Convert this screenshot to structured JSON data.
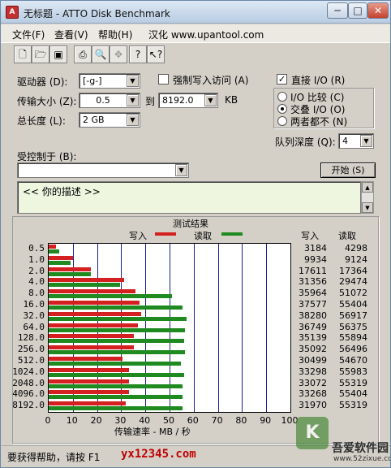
{
  "window": {
    "title": "无标题 - ATTO Disk Benchmark",
    "min_glyph": "─",
    "max_glyph": "□",
    "close_glyph": "✕",
    "icon_glyph": "A"
  },
  "menu": {
    "file": "文件(F)",
    "view": "查看(V)",
    "help": "帮助(H)",
    "localized": "汉化 www.upantool.com"
  },
  "toolbar": [
    {
      "name": "new-icon",
      "glyph": "🗋",
      "enabled": true
    },
    {
      "name": "open-icon",
      "glyph": "🗁",
      "enabled": true
    },
    {
      "name": "save-icon",
      "glyph": "▣",
      "enabled": true
    },
    {
      "name": "print-icon",
      "glyph": "⎙",
      "enabled": true
    },
    {
      "name": "print-preview-icon",
      "glyph": "🔍",
      "enabled": true
    },
    {
      "name": "move-icon",
      "glyph": "✥",
      "enabled": false
    },
    {
      "name": "help-icon",
      "glyph": "?",
      "enabled": true
    },
    {
      "name": "context-help-icon",
      "glyph": "↖?",
      "enabled": true
    }
  ],
  "settings": {
    "drive_label": "驱动器 (D):",
    "drive_value": "[-g-]",
    "force_write_label": "强制写入访问 (A)",
    "force_write_checked": false,
    "direct_io_label": "直接 I/O (R)",
    "direct_io_checked": true,
    "transfer_label": "传输大小 (Z):",
    "transfer_from": "0.5",
    "to_label": "到",
    "transfer_to": "8192.0",
    "unit": "KB",
    "length_label": "总长度 (L):",
    "length_value": "2 GB",
    "io_compare_label": "I/O 比较 (C)",
    "overlapped_label": "交叠 I/O (O)",
    "neither_label": "两者都不 (N)",
    "mode_selected": "overlapped",
    "queue_label": "队列深度 (Q):",
    "queue_value": "4",
    "controlled_label": "受控制于 (B):",
    "controlled_value": "",
    "start_label": "开始 (S)",
    "description": "<<  你的描述  >>"
  },
  "results": {
    "title": "测试结果",
    "write_label": "写入",
    "read_label": "读取",
    "col_write": "写入",
    "col_read": "读取",
    "x_title": "传输速率 - MB / 秒",
    "colors": {
      "write": "#d42020",
      "read": "#1f8a1f"
    }
  },
  "chart_data": {
    "type": "bar",
    "orientation": "horizontal",
    "categories": [
      "0.5",
      "1.0",
      "2.0",
      "4.0",
      "8.0",
      "16.0",
      "32.0",
      "64.0",
      "128.0",
      "256.0",
      "512.0",
      "1024.0",
      "2048.0",
      "4096.0",
      "8192.0"
    ],
    "series": [
      {
        "name": "写入",
        "values": [
          3184,
          9934,
          17611,
          31356,
          35964,
          37577,
          38280,
          36749,
          35139,
          35092,
          30499,
          33298,
          33072,
          33268,
          31970
        ]
      },
      {
        "name": "读取",
        "values": [
          4298,
          9124,
          17364,
          29474,
          51072,
          55404,
          56917,
          56375,
          55894,
          56496,
          54670,
          55983,
          55319,
          55404,
          55319
        ]
      }
    ],
    "xlabel": "传输速率 - MB / 秒",
    "xlim": [
      0,
      100
    ],
    "x_ticks": [
      0,
      10,
      20,
      30,
      40,
      50,
      60,
      70,
      80,
      90,
      100
    ],
    "grid": true,
    "legend": "top"
  },
  "status": {
    "help_text": "要获得帮助，请按 F1",
    "site": "yx12345.com"
  },
  "brand": {
    "logo_glyph": "K",
    "name": "吾爱软件园",
    "url": "www.52zixue.com"
  }
}
